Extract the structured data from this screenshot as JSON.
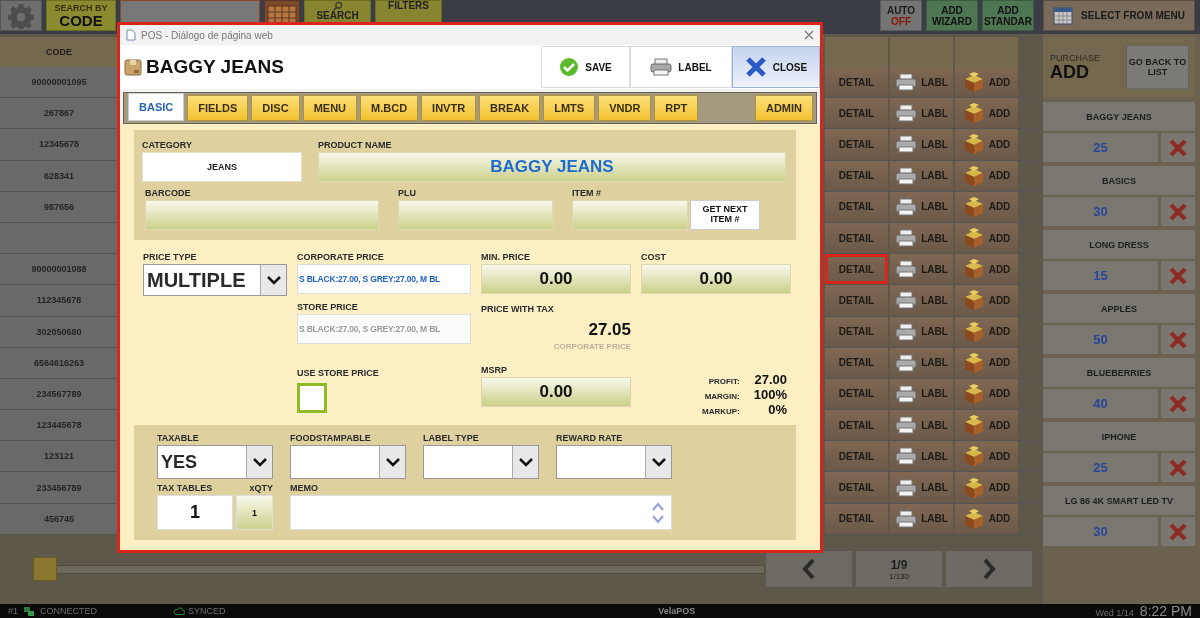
{
  "toolbar": {
    "search_mode": {
      "label": "SEARCH BY",
      "value": "CODE"
    },
    "search_button": "SEARCH",
    "filters_button": "FILTERS",
    "auto": {
      "label": "AUTO",
      "state": "OFF"
    },
    "add_wizard": "ADD WIZARD",
    "add_standard": "ADD STANDAR",
    "select_menu": "SELECT FROM MENU"
  },
  "table": {
    "columns": [
      "CODE"
    ],
    "rows": [
      {
        "code": "90000001095",
        "detail": "DETAIL",
        "label": "LABL",
        "add": "ADD",
        "selected": false
      },
      {
        "code": "267867",
        "detail": "DETAIL",
        "label": "LABL",
        "add": "ADD",
        "selected": false
      },
      {
        "code": "12345678",
        "detail": "DETAIL",
        "label": "LABL",
        "add": "ADD",
        "selected": false
      },
      {
        "code": "628341",
        "detail": "DETAIL",
        "label": "LABL",
        "add": "ADD",
        "selected": false
      },
      {
        "code": "987656",
        "detail": "DETAIL",
        "label": "LABL",
        "add": "ADD",
        "selected": false
      },
      {
        "detail": "DETAIL",
        "label": "LABL",
        "add": "ADD",
        "selected": false
      },
      {
        "code": "90000001088",
        "detail": "DETAIL",
        "label": "LABL",
        "add": "ADD",
        "selected": true
      },
      {
        "code": "112345678",
        "detail": "DETAIL",
        "label": "LABL",
        "add": "ADD",
        "selected": false
      },
      {
        "code": "302050680",
        "detail": "DETAIL",
        "label": "LABL",
        "add": "ADD",
        "selected": false
      },
      {
        "code": "6564616263",
        "detail": "DETAIL",
        "label": "LABL",
        "add": "ADD",
        "selected": false
      },
      {
        "code": "234567789",
        "detail": "DETAIL",
        "label": "LABL",
        "add": "ADD",
        "selected": false
      },
      {
        "code": "123445678",
        "detail": "DETAIL",
        "label": "LABL",
        "add": "ADD",
        "selected": false
      },
      {
        "code": "123121",
        "detail": "DETAIL",
        "label": "LABL",
        "add": "ADD",
        "selected": false
      },
      {
        "code": "233456789",
        "detail": "DETAIL",
        "label": "LABL",
        "add": "ADD",
        "selected": false
      },
      {
        "code": "456745",
        "detail": "DETAIL",
        "label": "LABL",
        "add": "ADD",
        "selected": false
      }
    ]
  },
  "purchase": {
    "caption": "PURCHASE",
    "mode": "ADD",
    "back_button": "GO BACK TO LIST",
    "items": [
      {
        "name": "BAGGY JEANS",
        "qty": "25"
      },
      {
        "name": "BASICS",
        "qty": "30"
      },
      {
        "name": "LONG DRESS",
        "qty": "15"
      },
      {
        "name": "APPLES",
        "qty": "50"
      },
      {
        "name": "BLUEBERRIES",
        "qty": "40"
      },
      {
        "name": "IPHONE",
        "qty": "25"
      },
      {
        "name": "LG 86 4K SMART LED TV",
        "qty": "30"
      }
    ]
  },
  "pager": {
    "slider": {
      "level": 0
    },
    "page": "1/9",
    "range": "1/130"
  },
  "status_bar": {
    "terminal": "#1",
    "connection": "CONNECTED",
    "sync": "SYNCED",
    "app": "VelaPOS",
    "date": "Wed 1/14",
    "time": "8:22 PM"
  },
  "dialog": {
    "window_title": "POS - Diálogo de página web",
    "title": "BAGGY JEANS",
    "buttons": [
      {
        "kind": "save",
        "label": "SAVE"
      },
      {
        "kind": "label",
        "label": "LABEL"
      },
      {
        "kind": "close",
        "label": "CLOSE"
      }
    ],
    "tabs": [
      {
        "label": "BASIC",
        "selected": true
      },
      {
        "label": "FIELDS",
        "selected": false
      },
      {
        "label": "DISC",
        "selected": false
      },
      {
        "label": "MENU",
        "selected": false
      },
      {
        "label": "M.BCD",
        "selected": false
      },
      {
        "label": "INVTR",
        "selected": false
      },
      {
        "label": "BREAK",
        "selected": false
      },
      {
        "label": "LMTS",
        "selected": false
      },
      {
        "label": "VNDR",
        "selected": false
      },
      {
        "label": "RPT",
        "selected": false
      }
    ],
    "side_tab": {
      "label": "ADMIN",
      "selected": false
    },
    "category": {
      "label": "CATEGORY",
      "value": "JEANS"
    },
    "product_name": {
      "label": "PRODUCT NAME",
      "value": "BAGGY JEANS"
    },
    "barcode": {
      "label": "BARCODE"
    },
    "plu": {
      "label": "PLU"
    },
    "item_number": {
      "label": "ITEM #",
      "button": "GET NEXT ITEM #"
    },
    "price_type": {
      "label": "PRICE TYPE",
      "value": "MULTIPLE"
    },
    "corporate_price": {
      "label": "CORPORATE PRICE",
      "value": "S BLACK:27.00, S GREY:27.00, M BL"
    },
    "store_price": {
      "label": "STORE PRICE",
      "value": "S BLACK:27.00, S GREY:27.00, M BL",
      "disabled": true
    },
    "use_store_price": {
      "label": "USE STORE PRICE",
      "checked": false
    },
    "min_price": {
      "label": "MIN. PRICE",
      "value": "0.00"
    },
    "cost": {
      "label": "COST",
      "value": "0.00"
    },
    "price_with_tax": {
      "label": "PRICE WITH TAX",
      "value": "27.05",
      "note": "CORPORATE PRICE"
    },
    "msrp": {
      "label": "MSRP",
      "value": "0.00"
    },
    "summary": [
      {
        "label": "PROFIT:",
        "value": "27.00"
      },
      {
        "label": "MARGIN:",
        "value": "100%"
      },
      {
        "label": "MARKUP:",
        "value": "0%"
      }
    ],
    "selects": [
      {
        "label": "TAXABLE",
        "value": "YES"
      },
      {
        "label": "FOODSTAMPABLE"
      },
      {
        "label": "LABEL TYPE"
      },
      {
        "label": "REWARD RATE"
      }
    ],
    "tax_tables": {
      "label": "TAX TABLES",
      "value": "1"
    },
    "xqty": {
      "label": "xQTY",
      "value": "1"
    },
    "memo": {
      "label": "MEMO"
    }
  }
}
